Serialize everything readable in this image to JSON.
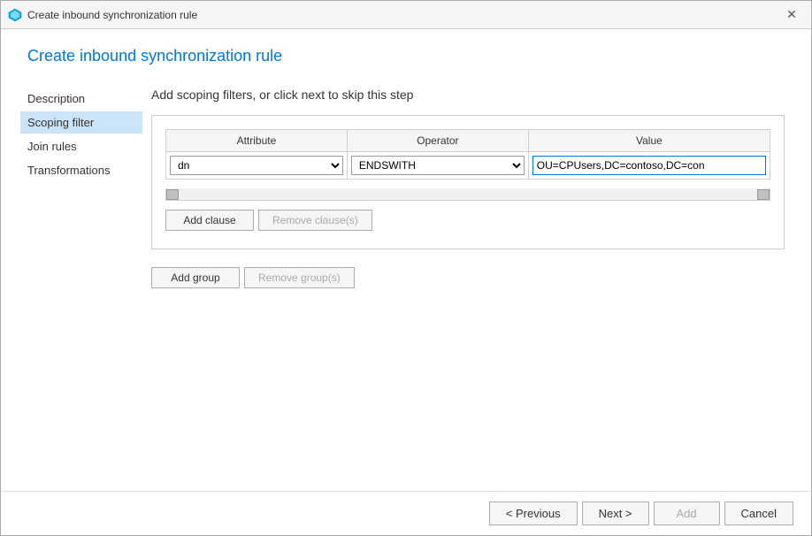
{
  "window": {
    "title": "Create inbound synchronization rule",
    "close_label": "✕"
  },
  "page_title": "Create inbound synchronization rule",
  "sidebar": {
    "items": [
      {
        "id": "description",
        "label": "Description",
        "active": false
      },
      {
        "id": "scoping-filter",
        "label": "Scoping filter",
        "active": true
      },
      {
        "id": "join-rules",
        "label": "Join rules",
        "active": false
      },
      {
        "id": "transformations",
        "label": "Transformations",
        "active": false
      }
    ]
  },
  "main": {
    "step_title": "Add scoping filters, or click next to skip this step",
    "table": {
      "columns": [
        "Attribute",
        "Operator",
        "Value"
      ],
      "row": {
        "attribute": "dn",
        "operator": "ENDSWITH",
        "value": "OU=CPUsers,DC=contoso,DC=con"
      }
    },
    "buttons": {
      "add_clause": "Add clause",
      "remove_clause": "Remove clause(s)",
      "add_group": "Add group",
      "remove_group": "Remove group(s)"
    }
  },
  "footer": {
    "previous_label": "< Previous",
    "next_label": "Next >",
    "add_label": "Add",
    "cancel_label": "Cancel"
  }
}
